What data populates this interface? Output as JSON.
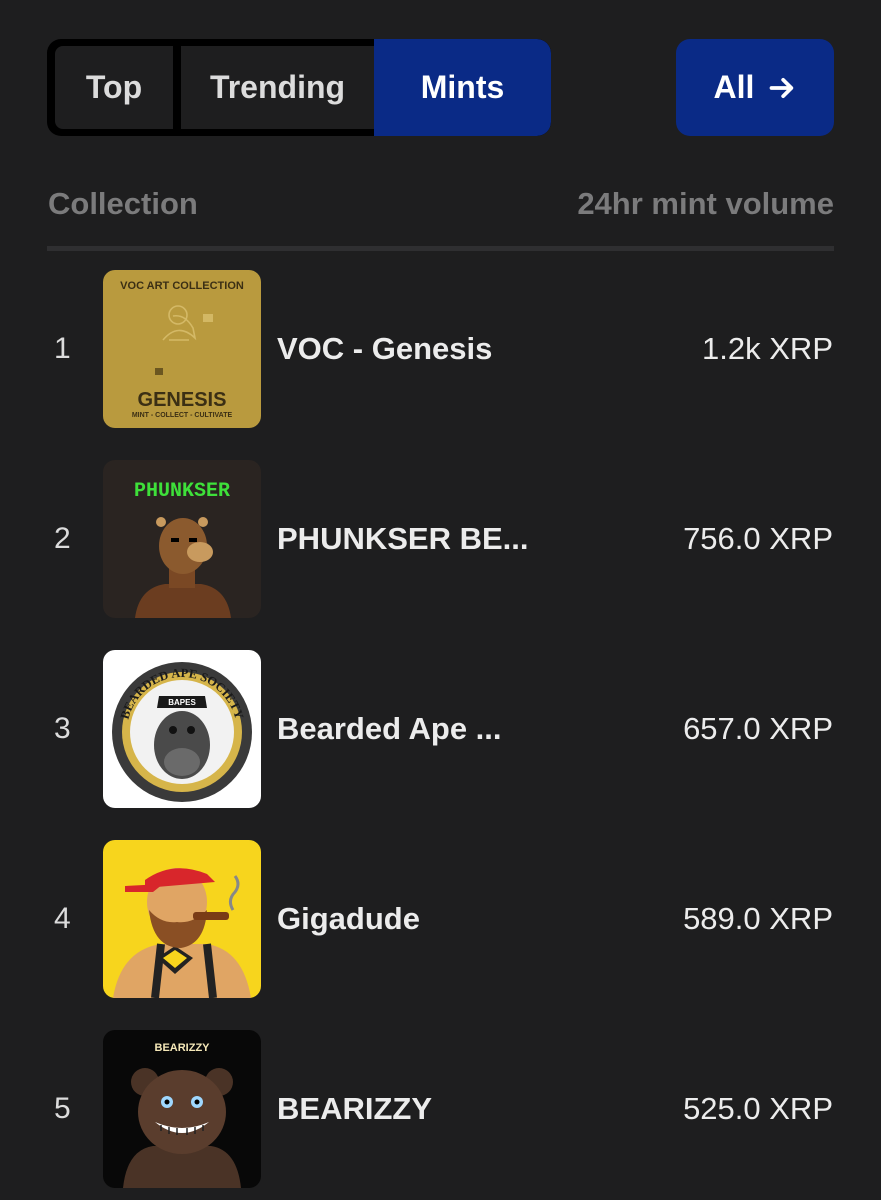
{
  "tabs": [
    {
      "label": "Top"
    },
    {
      "label": "Trending"
    },
    {
      "label": "Mints",
      "active": true
    }
  ],
  "all_button": {
    "label": "All",
    "icon": "arrow-right-icon"
  },
  "table_header": {
    "collection": "Collection",
    "volume": "24hr mint volume"
  },
  "colors": {
    "background": "#1e1e1f",
    "accent": "#0a2a86",
    "muted": "#7b7b7c"
  },
  "rows": [
    {
      "rank": "1",
      "name": "VOC - Genesis",
      "volume": "1.2k XRP",
      "thumb": {
        "top_text": "VOC ART COLLECTION",
        "title": "GENESIS",
        "subtitle": "MINT - COLLECT - CULTIVATE"
      }
    },
    {
      "rank": "2",
      "name": "PHUNKSER BE...",
      "volume": "756.0 XRP",
      "thumb": {
        "title": "PHUNKSER"
      }
    },
    {
      "rank": "3",
      "name": "Bearded Ape ...",
      "volume": "657.0 XRP",
      "thumb": {
        "title": "BEARDED APE SOCIETY",
        "cap_text": "BAPES"
      }
    },
    {
      "rank": "4",
      "name": "Gigadude",
      "volume": "589.0 XRP",
      "thumb": {}
    },
    {
      "rank": "5",
      "name": "BEARIZZY",
      "volume": "525.0 XRP",
      "thumb": {
        "title": "BEARIZZY"
      }
    }
  ]
}
